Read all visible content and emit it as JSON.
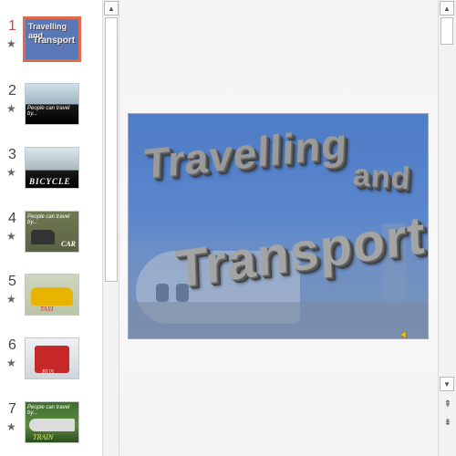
{
  "slides": [
    {
      "number": "1",
      "caption_line1": "Travelling and",
      "caption_line2": "Transport",
      "active": true
    },
    {
      "number": "2",
      "caption": "People can travel by..."
    },
    {
      "number": "3",
      "caption": "BICYCLE"
    },
    {
      "number": "4",
      "caption": "People can travel by...",
      "label": "CAR"
    },
    {
      "number": "5",
      "label": "TAXI"
    },
    {
      "number": "6",
      "label": "BUS"
    },
    {
      "number": "7",
      "caption": "People can travel by...",
      "label": "TRAIN"
    }
  ],
  "main_slide": {
    "title_word1": "Travelling",
    "title_word2": "and",
    "title_word3": "Transport"
  },
  "icons": {
    "star": "★",
    "scroll_up": "▲",
    "scroll_down": "▼",
    "prev_slide": "⇞",
    "next_slide": "⇟"
  },
  "colors": {
    "active_border": "#e06a4a",
    "active_number": "#c0504d",
    "slide_bg": "#5a86cc"
  }
}
